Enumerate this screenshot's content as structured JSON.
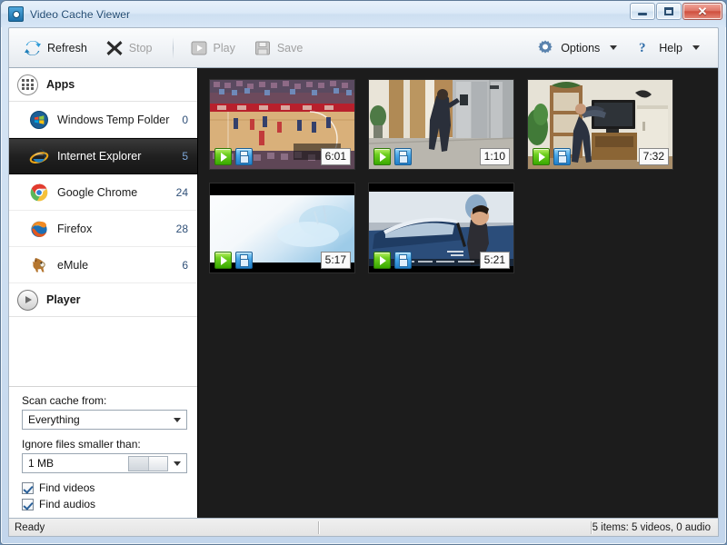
{
  "window": {
    "title": "Video Cache Viewer",
    "app_icon": "video-lens-icon",
    "controls": {
      "minimize": "minimize-button",
      "maximize": "maximize-button",
      "close": "close-button",
      "close_glyph": "✕"
    }
  },
  "toolbar": {
    "items": [
      {
        "label": "Refresh",
        "icon": "refresh-icon",
        "enabled": true
      },
      {
        "label": "Stop",
        "icon": "stop-icon",
        "enabled": false
      },
      {
        "label": "Play",
        "icon": "play-icon",
        "enabled": false
      },
      {
        "label": "Save",
        "icon": "save-icon",
        "enabled": false
      }
    ],
    "right_items": [
      {
        "label": "Options",
        "icon": "gear-icon",
        "has_caret": true
      },
      {
        "label": "Help",
        "icon": "question-mark-icon",
        "has_caret": true
      }
    ]
  },
  "sidebar": {
    "groups": [
      {
        "header": "Apps",
        "icon": "app-grid-icon"
      },
      {
        "header": "Player",
        "icon": "player-play-icon"
      }
    ],
    "apps": [
      {
        "label": "Windows Temp Folder",
        "count": "0",
        "icon": "windows-logo-icon",
        "selected": false
      },
      {
        "label": "Internet Explorer",
        "count": "5",
        "icon": "internet-explorer-icon",
        "selected": true
      },
      {
        "label": "Google Chrome",
        "count": "24",
        "icon": "google-chrome-icon",
        "selected": false
      },
      {
        "label": "Firefox",
        "count": "28",
        "icon": "firefox-icon",
        "selected": false
      },
      {
        "label": "eMule",
        "count": "6",
        "icon": "emule-donkey-icon",
        "selected": false
      }
    ],
    "options": {
      "scan_label": "Scan cache from:",
      "scan_value": "Everything",
      "ignore_label": "Ignore files smaller than:",
      "ignore_value": "1 MB",
      "find_videos_label": "Find videos",
      "find_audios_label": "Find audios",
      "find_videos_checked": true,
      "find_audios_checked": true
    }
  },
  "thumbnails": [
    {
      "duration": "6:01",
      "scene": "basketball-game",
      "play_icon": "play-overlay-icon",
      "save_icon": "save-overlay-icon"
    },
    {
      "duration": "1:10",
      "scene": "elevator-lobby",
      "play_icon": "play-overlay-icon",
      "save_icon": "save-overlay-icon"
    },
    {
      "duration": "7:32",
      "scene": "living-room",
      "play_icon": "play-overlay-icon",
      "save_icon": "save-overlay-icon"
    },
    {
      "duration": "5:17",
      "scene": "bright-sky",
      "play_icon": "play-overlay-icon",
      "save_icon": "save-overlay-icon"
    },
    {
      "duration": "5:21",
      "scene": "convertible-car",
      "play_icon": "play-overlay-icon",
      "save_icon": "save-overlay-icon"
    }
  ],
  "statusbar": {
    "left": "Ready",
    "right": "5 items: 5 videos, 0 audio"
  },
  "colors": {
    "selection": "#1d1d1d",
    "content_bg": "#1c1c1c",
    "accent": "#2f4f77",
    "close_button": "#cf4f3e",
    "play_green": "#39a800",
    "save_blue": "#1f7fc9"
  }
}
